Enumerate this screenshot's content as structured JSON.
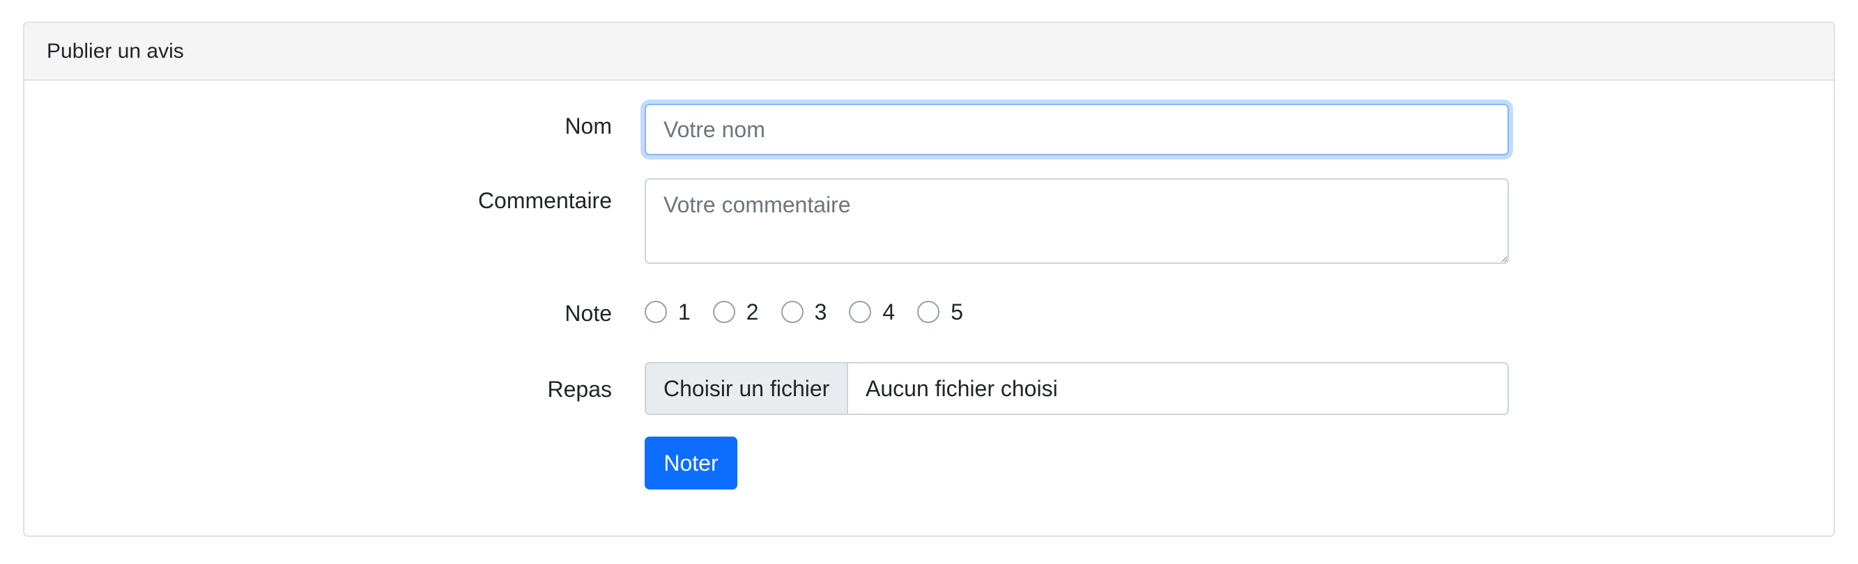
{
  "card": {
    "title": "Publier un avis"
  },
  "form": {
    "name": {
      "label": "Nom",
      "placeholder": "Votre nom",
      "value": ""
    },
    "comment": {
      "label": "Commentaire",
      "placeholder": "Votre commentaire",
      "value": ""
    },
    "rating": {
      "label": "Note",
      "options": [
        "1",
        "2",
        "3",
        "4",
        "5"
      ]
    },
    "meal": {
      "label": "Repas",
      "button_label": "Choisir un fichier",
      "file_status": "Aucun fichier choisi"
    },
    "submit_label": "Noter"
  },
  "colors": {
    "primary": "#0d6efd",
    "focus_border": "#86b7fe",
    "header_bg": "#f5f5f5"
  }
}
